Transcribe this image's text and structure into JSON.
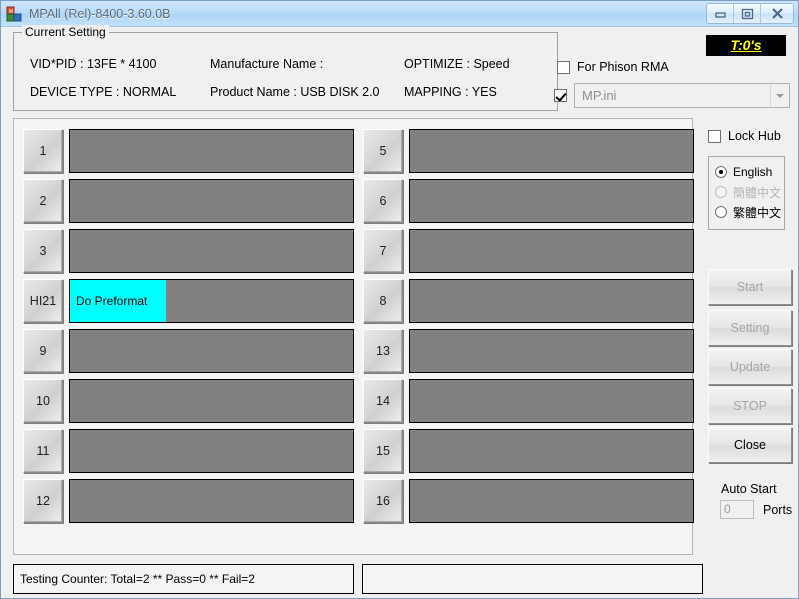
{
  "window": {
    "title": "MPAll (Rel)-8400-3.60.0B",
    "icon": "app-blocks-icon",
    "controls": {
      "minimize": "minimize-icon",
      "restore": "restore-icon",
      "close": "close-icon"
    }
  },
  "current_setting": {
    "legend": "Current Setting",
    "vid_pid": "VID*PID : 13FE * 4100",
    "device_type": "DEVICE TYPE : NORMAL",
    "manufacture_name": "Manufacture Name :",
    "product_name": "Product Name : USB DISK 2.0",
    "optimize": "OPTIMIZE : Speed",
    "mapping": "MAPPING : YES"
  },
  "header_right": {
    "timer_badge": "T:0's",
    "timer_badge_bg": "#000000",
    "timer_badge_color": "#ffff00",
    "phison_rma_label": "For Phison RMA",
    "phison_rma_checked": false,
    "ini_checked": true,
    "ini_value": "MP.ini"
  },
  "side_panel": {
    "lock_hub_label": "Lock Hub",
    "lock_hub_checked": false,
    "languages": [
      {
        "label": "English",
        "selected": true,
        "disabled": false
      },
      {
        "label": "簡體中文",
        "selected": false,
        "disabled": true
      },
      {
        "label": "繁體中文",
        "selected": false,
        "disabled": false
      }
    ],
    "buttons": [
      {
        "label": "Start",
        "disabled": true
      },
      {
        "label": "Setting",
        "disabled": true
      },
      {
        "label": "Update",
        "disabled": true
      },
      {
        "label": "STOP",
        "disabled": true
      },
      {
        "label": "Close",
        "disabled": false
      }
    ],
    "auto_start_label": "Auto Start",
    "ports_value": "0",
    "ports_label": "Ports"
  },
  "ports": {
    "bar_bg_color": "#808080",
    "active_color": "#00ffff",
    "left": [
      {
        "id": "1",
        "status": "",
        "progress": 0
      },
      {
        "id": "2",
        "status": "",
        "progress": 0
      },
      {
        "id": "3",
        "status": "",
        "progress": 0
      },
      {
        "id": "HI21",
        "status": "Do Preformat",
        "progress": 34
      },
      {
        "id": "9",
        "status": "",
        "progress": 0
      },
      {
        "id": "10",
        "status": "",
        "progress": 0
      },
      {
        "id": "11",
        "status": "",
        "progress": 0
      },
      {
        "id": "12",
        "status": "",
        "progress": 0
      }
    ],
    "right": [
      {
        "id": "5",
        "status": "",
        "progress": 0
      },
      {
        "id": "6",
        "status": "",
        "progress": 0
      },
      {
        "id": "7",
        "status": "",
        "progress": 0
      },
      {
        "id": "8",
        "status": "",
        "progress": 0
      },
      {
        "id": "13",
        "status": "",
        "progress": 0
      },
      {
        "id": "14",
        "status": "",
        "progress": 0
      },
      {
        "id": "15",
        "status": "",
        "progress": 0
      },
      {
        "id": "16",
        "status": "",
        "progress": 0
      }
    ]
  },
  "status": {
    "left_text": "Testing Counter: Total=2 ** Pass=0 ** Fail=2",
    "right_text": ""
  }
}
